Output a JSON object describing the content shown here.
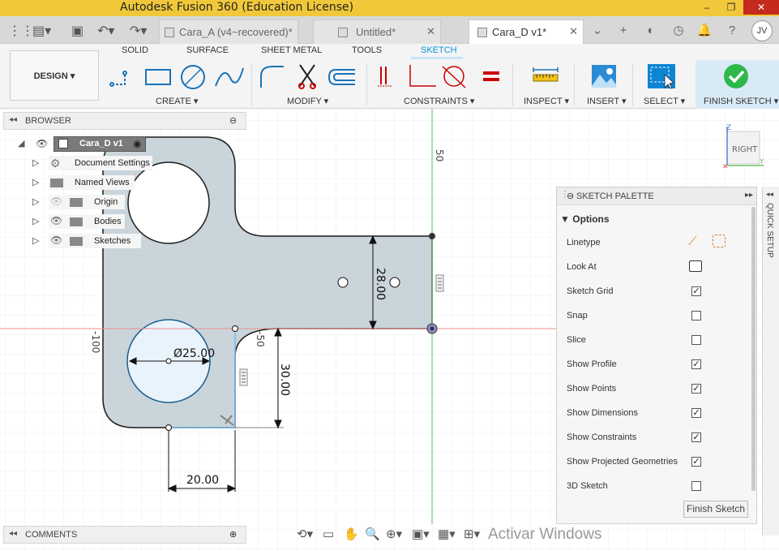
{
  "app": {
    "title": "Autodesk Fusion 360 (Education License)",
    "window_controls": [
      "–",
      "❐",
      "✕"
    ]
  },
  "tabs": [
    {
      "label": "Cara_A (v4~recovered)*"
    },
    {
      "label": "Untitled*"
    },
    {
      "label": "Cara_D v1*"
    }
  ],
  "user_initials": "JV",
  "workspace": {
    "label": "DESIGN ▾"
  },
  "ribbon_tabs": [
    "SOLID",
    "SURFACE",
    "SHEET METAL",
    "TOOLS",
    "SKETCH"
  ],
  "groups": {
    "create": "CREATE ▾",
    "modify": "MODIFY ▾",
    "constraints": "CONSTRAINTS ▾",
    "inspect": "INSPECT ▾",
    "insert": "INSERT ▾",
    "select": "SELECT ▾",
    "finish_sketch": "FINISH SKETCH ▾"
  },
  "browser": {
    "header": "BROWSER",
    "root": "Cara_D v1",
    "items": [
      "Document Settings",
      "Named Views",
      "Origin",
      "Bodies",
      "Sketches"
    ]
  },
  "viewcube": {
    "face": "RIGHT",
    "axis_z": "Z",
    "axis_y": "Y"
  },
  "sketch": {
    "diameter": "Ø25.00",
    "dim_28": "28.00",
    "dim_30": "30.00",
    "dim_20": "20.00",
    "axis_50": "50",
    "axis_neg50": "-50",
    "axis_neg100": "-100"
  },
  "palette": {
    "header": "SKETCH PALETTE",
    "section": "Options",
    "rows": [
      {
        "label": "Linetype",
        "type": "icons"
      },
      {
        "label": "Look At",
        "type": "icon"
      },
      {
        "label": "Sketch Grid",
        "checked": true
      },
      {
        "label": "Snap",
        "checked": false
      },
      {
        "label": "Slice",
        "checked": false
      },
      {
        "label": "Show Profile",
        "checked": true
      },
      {
        "label": "Show Points",
        "checked": true
      },
      {
        "label": "Show Dimensions",
        "checked": true
      },
      {
        "label": "Show Constraints",
        "checked": true
      },
      {
        "label": "Show Projected Geometries",
        "checked": true
      },
      {
        "label": "3D Sketch",
        "checked": false
      }
    ],
    "finish_button": "Finish Sketch"
  },
  "quick_setup": "QUICK SETUP",
  "comments": "COMMENTS",
  "watermark": "Activar Windows",
  "colors": {
    "titlebar": "#f0c83a",
    "accent": "#0696d7",
    "profile_fill": "#c4d0d8",
    "green_check": "#2eb84a"
  }
}
